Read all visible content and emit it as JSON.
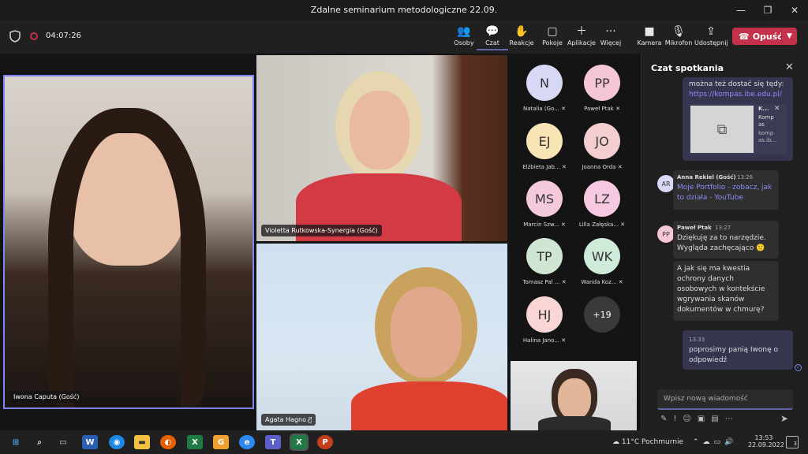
{
  "window": {
    "title": "Zdalne seminarium metodologiczne 22.09.",
    "minimize": "—",
    "maximize": "❐",
    "close": "✕"
  },
  "toolbar": {
    "timer": "04:07:26",
    "buttons": [
      {
        "label": "Osoby",
        "icon": "people-icon"
      },
      {
        "label": "Czat",
        "icon": "chat-icon"
      },
      {
        "label": "Reakcje",
        "icon": "reactions-icon"
      },
      {
        "label": "Pokoje",
        "icon": "rooms-icon"
      },
      {
        "label": "Aplikacje",
        "icon": "apps-icon"
      },
      {
        "label": "Więcej",
        "icon": "more-icon"
      },
      {
        "label": "Kamera",
        "icon": "camera-icon"
      },
      {
        "label": "Mikrofon",
        "icon": "microphone-icon"
      },
      {
        "label": "Udostępnij",
        "icon": "share-icon"
      }
    ],
    "leave_label": "Opuść"
  },
  "videos": {
    "main": "Iwona Caputa (Gość)",
    "top_right": "Violetta Rutkowska-Synergia (Gość)",
    "bottom_right": "Agata Hagno"
  },
  "participants": [
    {
      "initials": "N",
      "name": "Natalia (Go...",
      "color": "#d6d8f5"
    },
    {
      "initials": "PP",
      "name": "Paweł Ptak",
      "color": "#f5c6d8"
    },
    {
      "initials": "EJ",
      "name": "Elżbieta Jab...",
      "color": "#f8e4b4"
    },
    {
      "initials": "JO",
      "name": "Joanna Orda",
      "color": "#f3cdd0"
    },
    {
      "initials": "MS",
      "name": "Marcin Szw...",
      "color": "#f5c9dc"
    },
    {
      "initials": "LZ",
      "name": "Lilla Załęska...",
      "color": "#f6c9e0"
    },
    {
      "initials": "TP",
      "name": "Tomasz Pal ...",
      "color": "#cfe6d3"
    },
    {
      "initials": "WK",
      "name": "Wanda Koz...",
      "color": "#cdebd8"
    },
    {
      "initials": "HJ",
      "name": "Halina Jano...",
      "color": "#f9d5d5"
    },
    {
      "initials": "+19",
      "name": "",
      "color": "#3a3a3a"
    }
  ],
  "chat": {
    "title": "Czat spotkania",
    "msg0_text": "można też dostać się tędy:",
    "msg0_link": "https://kompas.ibe.edu.pl/",
    "preview_title": "K...",
    "preview_line1": "Komp",
    "preview_line2": "as",
    "preview_line3": "komp",
    "preview_line4": "as.ib...",
    "msg1": {
      "initials": "AR",
      "author": "Anna Rekiel (Gość)",
      "time": "13:26",
      "text": "Moje Portfolio - zobacz, jak to działa - YouTube"
    },
    "msg2": {
      "initials": "PP",
      "author": "Paweł Ptak",
      "time": "13:27",
      "text": "Dziękuję za to narzędzie. Wygląda zachęcająco",
      "text2": "A jak się ma kwestia ochrony danych osobowych w kontekście wgrywania skanów dokumentów w chmurę?"
    },
    "msg3": {
      "time": "13:33",
      "text": "poprosimy panią Iwonę o odpowiedź"
    },
    "input_placeholder": "Wpisz nową wiadomość"
  },
  "taskbar": {
    "weather": "11°C  Pochmurnie",
    "time": "13:53",
    "date": "22.09.2022",
    "notifications": "3"
  },
  "colors": {
    "accent": "#6264a7",
    "leave": "#c4314b",
    "chat_bg": "#1f1f1f"
  }
}
